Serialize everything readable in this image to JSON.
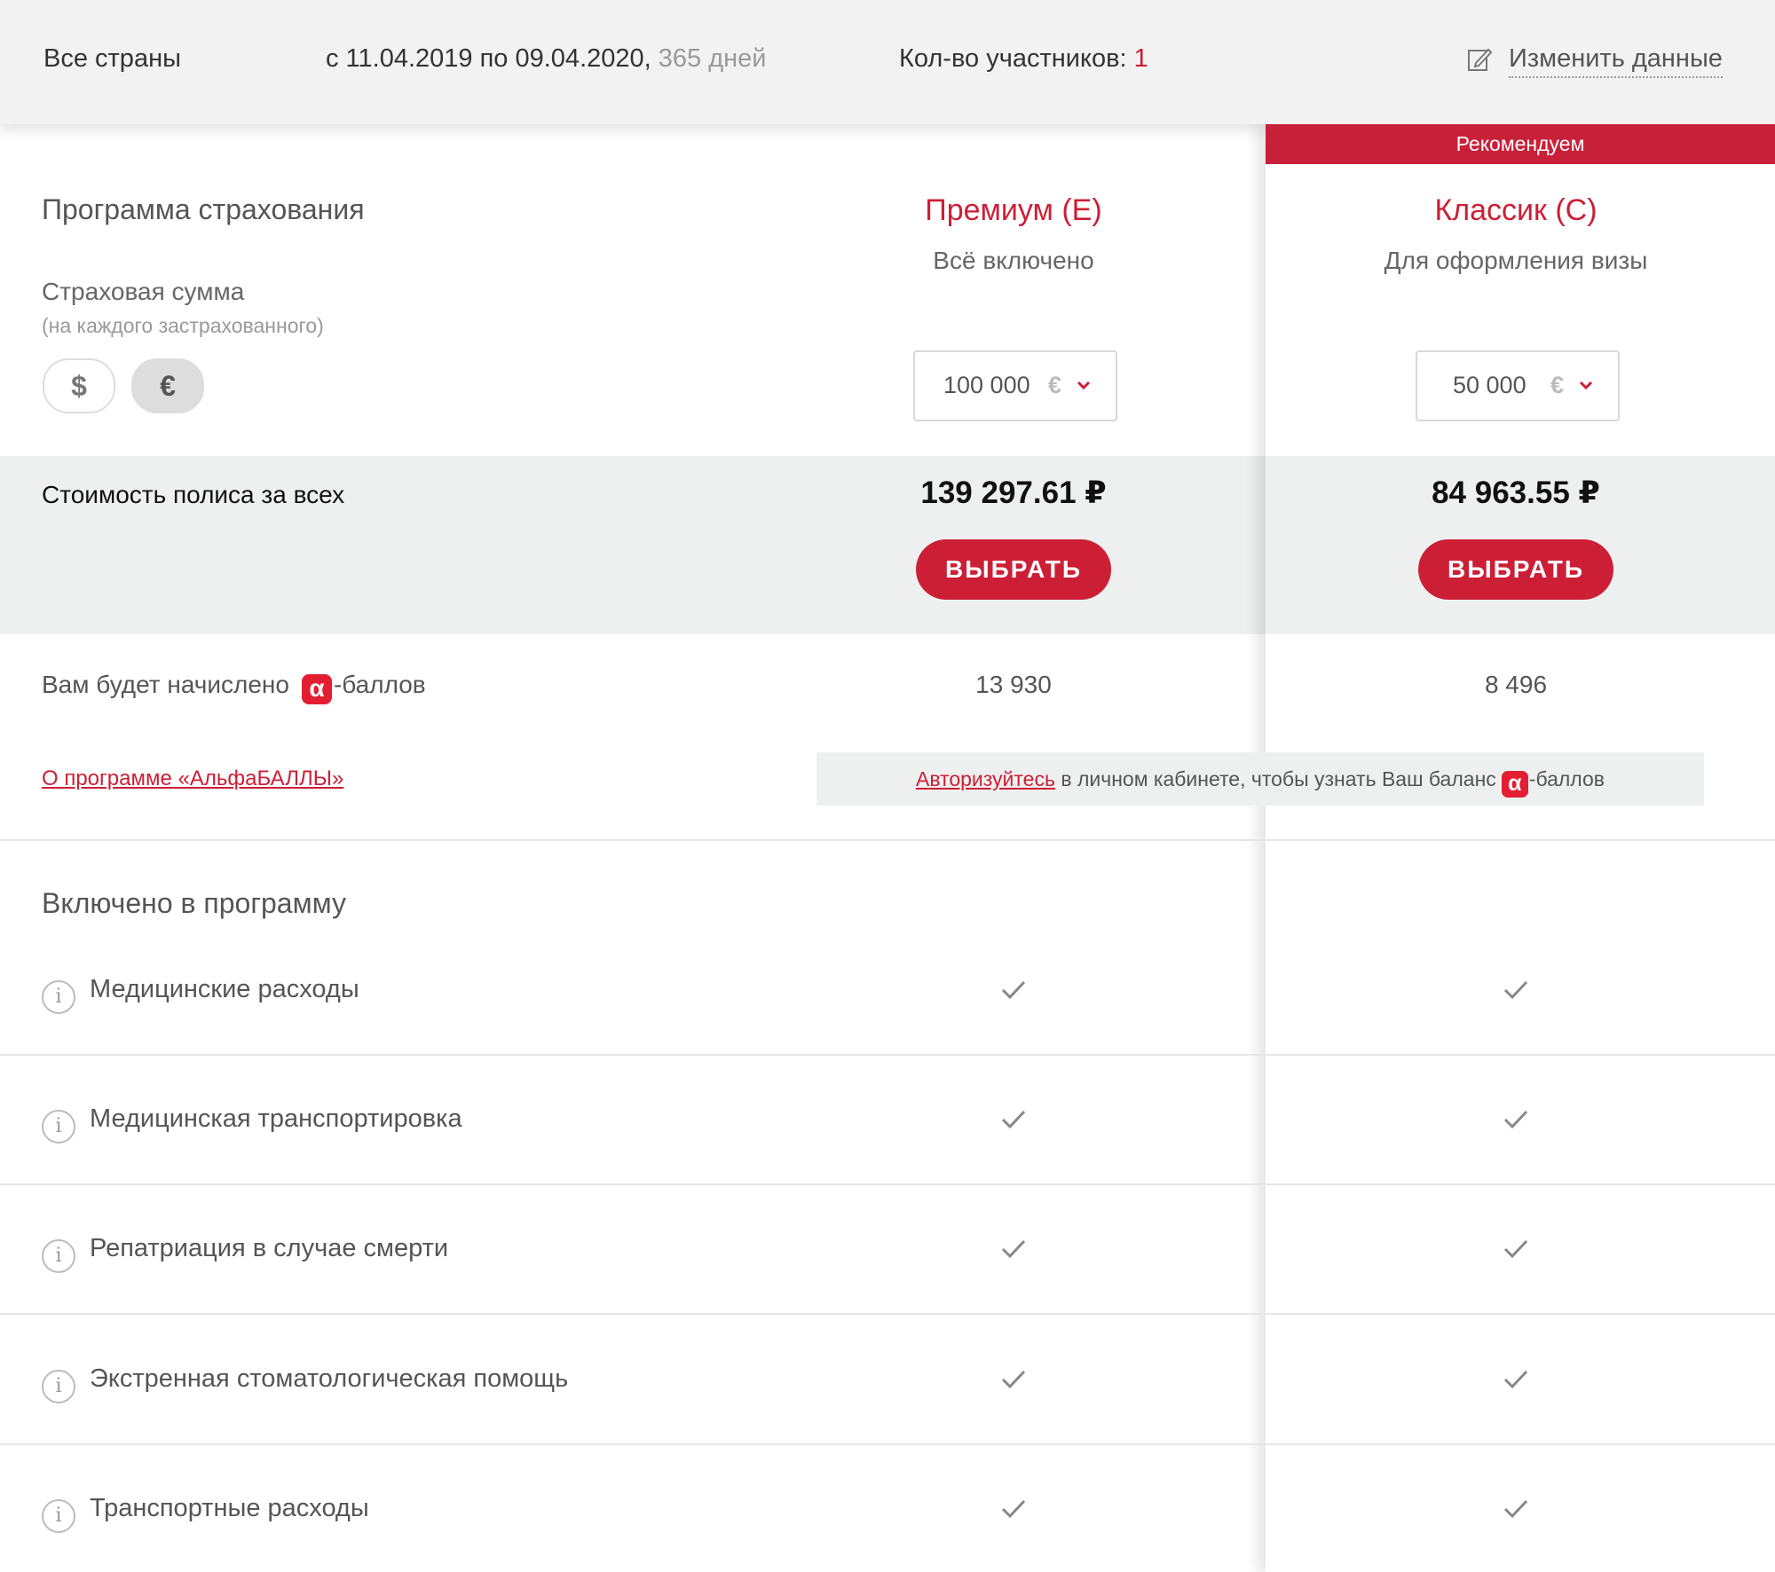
{
  "header": {
    "countries": "Все страны",
    "dates": "с 11.04.2019 по 09.04.2020,",
    "days": "365 дней",
    "participants_label": "Кол-во участников:",
    "participants_count": "1",
    "edit_label": "Изменить данные",
    "edit_icon": "pencil-icon"
  },
  "left": {
    "program_title": "Программа страхования",
    "sum_label": "Страховая сумма",
    "sum_note": "(на каждого застрахованного)",
    "currency_usd": "$",
    "currency_eur": "€",
    "selected_currency": "EUR",
    "cost_label": "Стоимость полиса за всех",
    "points_label_pre": "Вам будет начислено",
    "alpha_glyph": "α",
    "points_label_post": "-баллов",
    "about_link": "О программе «АльфаБАЛЛЫ»",
    "included_title": "Включено в программу"
  },
  "plans": [
    {
      "name": "Премиум (E)",
      "subtitle": "Всё включено",
      "sum": "100 000",
      "currency": "€",
      "price": "139 297.61 ₽",
      "button": "ВЫБРАТЬ",
      "points": "13 930",
      "recommended": false
    },
    {
      "name": "Классик (С)",
      "subtitle": "Для оформления визы",
      "sum": "50 000",
      "currency": "€",
      "price": "84 963.55 ₽",
      "button": "ВЫБРАТЬ",
      "points": "8 496",
      "recommended": true
    }
  ],
  "recommended_badge": "Рекомендуем",
  "auth": {
    "link": "Авторизуйтесь",
    "text": " в личном кабинете, чтобы узнать Ваш баланс",
    "suffix": "-баллов"
  },
  "features": [
    {
      "label": "Медицинские расходы",
      "plan1": true,
      "plan2": true
    },
    {
      "label": "Медицинская транспортировка",
      "plan1": true,
      "plan2": true
    },
    {
      "label": "Репатриация в случае смерти",
      "plan1": true,
      "plan2": true
    },
    {
      "label": "Экстренная стоматологическая помощь",
      "plan1": true,
      "plan2": true
    },
    {
      "label": "Транспортные расходы",
      "plan1": true,
      "plan2": true
    }
  ],
  "colors": {
    "accent": "#cc1f36",
    "band": "#eef0f0",
    "topbar": "#f2f2f2"
  }
}
